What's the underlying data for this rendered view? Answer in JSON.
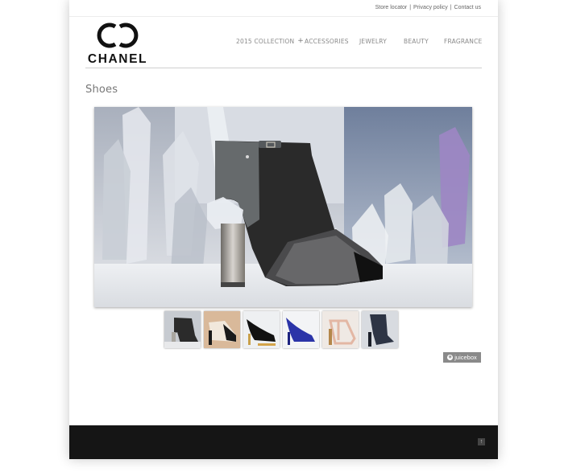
{
  "utility_nav": {
    "store_locator": "Store locator",
    "privacy_policy": "Privacy policy",
    "contact_us": "Contact us",
    "separator": "|"
  },
  "brand": {
    "wordmark": "CHANEL"
  },
  "main_nav": {
    "items": [
      {
        "label": "2015 COLLECTION",
        "icon": "plus-icon"
      },
      {
        "label": "ACCESSORIES"
      },
      {
        "label": "JEWELRY"
      },
      {
        "label": "BEAUTY"
      },
      {
        "label": "FRAGRANCE"
      }
    ],
    "plus_glyph": "+"
  },
  "page": {
    "title": "Shoes"
  },
  "gallery": {
    "thumbnail_count": 6,
    "selected_index": 0,
    "badge_label": "juicebox",
    "badge_icon": "juicebox-logo-icon"
  },
  "footer": {
    "back_to_top_icon": "arrow-up-icon",
    "back_to_top_glyph": "↑"
  },
  "colors": {
    "footer_bg": "#151515",
    "nav_text": "#8a8a8a",
    "title_text": "#777777",
    "badge_bg": "#8a8a8a"
  }
}
